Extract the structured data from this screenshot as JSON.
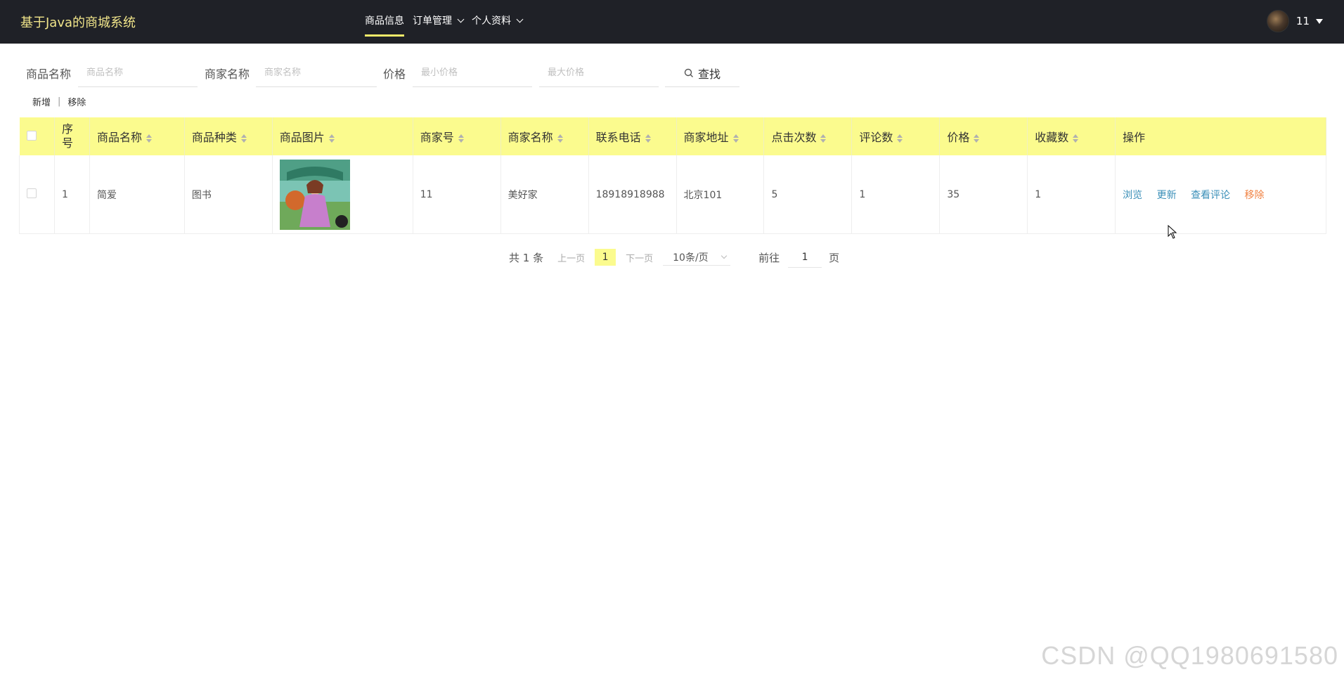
{
  "brand": "基于Java的商城系统",
  "nav": {
    "items": [
      {
        "label": "商品信息",
        "active": true
      },
      {
        "label": "订单管理",
        "dropdown": true
      },
      {
        "label": "个人资料",
        "dropdown": true
      }
    ]
  },
  "user": {
    "name": "11"
  },
  "search": {
    "name_label": "商品名称",
    "name_placeholder": "商品名称",
    "shop_label": "商家名称",
    "shop_placeholder": "商家名称",
    "price_label": "价格",
    "min_placeholder": "最小价格",
    "max_placeholder": "最大价格",
    "button_label": "查找"
  },
  "actions": {
    "add_label": "新增",
    "separator": "|",
    "remove_label": "移除"
  },
  "table": {
    "columns": [
      "序号",
      "商品名称",
      "商品种类",
      "商品图片",
      "商家号",
      "商家名称",
      "联系电话",
      "商家地址",
      "点击次数",
      "评论数",
      "价格",
      "收藏数",
      "操作"
    ],
    "rows": [
      {
        "index": "1",
        "name": "简爱",
        "category": "图书",
        "shop_no": "11",
        "shop_name": "美好家",
        "phone": "18918918988",
        "address": "北京101",
        "clicks": "5",
        "comments": "1",
        "price": "35",
        "favorites": "1",
        "ops": {
          "view": "浏览",
          "update": "更新",
          "comments": "查看评论",
          "remove": "移除"
        }
      }
    ]
  },
  "pagination": {
    "total_text": "共 1 条",
    "prev": "上一页",
    "current": "1",
    "next": "下一页",
    "page_size": "10条/页",
    "goto_label": "前往",
    "goto_value": "1",
    "page_suffix": "页"
  },
  "watermark": "CSDN @QQ1980691580",
  "colors": {
    "topbar": "#1f2127",
    "brand": "#f1e58a",
    "accent": "#fbfb8e",
    "link": "#3a8fb8",
    "danger": "#f08040"
  }
}
